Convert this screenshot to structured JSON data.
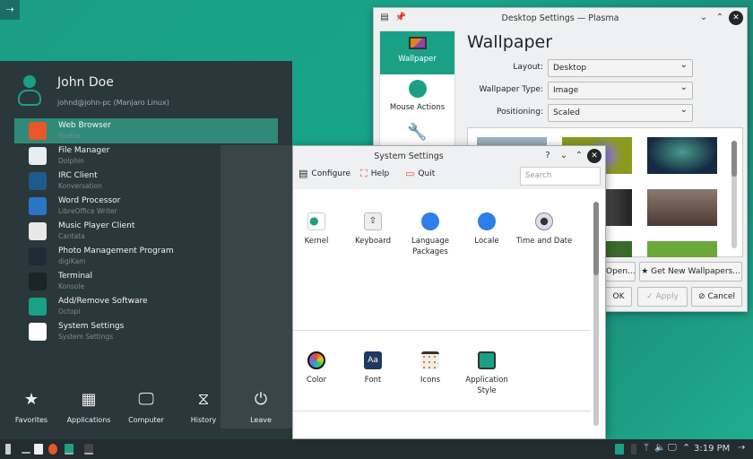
{
  "desktop": {
    "corner_icon": "⇢"
  },
  "desktop_settings": {
    "title": "Desktop Settings — Plasma",
    "sidebar": [
      {
        "label": "Wallpaper",
        "icon": "monitor-icon",
        "selected": true
      },
      {
        "label": "Mouse Actions",
        "icon": "mouse-icon"
      },
      {
        "label": "",
        "icon": "wrench-icon"
      }
    ],
    "heading": "Wallpaper",
    "fields": [
      {
        "label": "Layout:",
        "value": "Desktop"
      },
      {
        "label": "Wallpaper Type:",
        "value": "Image"
      },
      {
        "label": "Positioning:",
        "value": "Scaled"
      }
    ],
    "buttons": {
      "open": "Open...",
      "get_new": "Get New Wallpapers...",
      "ok": "OK",
      "apply": "Apply",
      "cancel": "Cancel"
    }
  },
  "system_settings": {
    "title": "System Settings",
    "toolbar": {
      "configure": "Configure",
      "help": "Help",
      "quit": "Quit"
    },
    "search_placeholder": "Search",
    "row1": [
      {
        "label": "Kernel"
      },
      {
        "label": "Keyboard"
      },
      {
        "label": "Language Packages"
      },
      {
        "label": "Locale"
      },
      {
        "label": "Time and Date"
      }
    ],
    "row2": [
      {
        "label": "Color"
      },
      {
        "label": "Font"
      },
      {
        "label": "Icons"
      },
      {
        "label": "Application Style"
      }
    ]
  },
  "menu": {
    "user_name": "John Doe",
    "user_sub": "johnd@john-pc (Manjaro Linux)",
    "items": [
      {
        "title": "Web Browser",
        "sub": "Firefox",
        "color": "#e8562a"
      },
      {
        "title": "File Manager",
        "sub": "Dolphin",
        "color": "#e6eef0"
      },
      {
        "title": "IRC Client",
        "sub": "Konversation",
        "color": "#1d5a8e"
      },
      {
        "title": "Word Processor",
        "sub": "LibreOffice Writer",
        "color": "#2a76c6"
      },
      {
        "title": "Music Player Client",
        "sub": "Cantata",
        "color": "#e8e8e8"
      },
      {
        "title": "Photo Management Program",
        "sub": "digiKam",
        "color": "#1e2a38"
      },
      {
        "title": "Terminal",
        "sub": "Konsole",
        "color": "#1b2426"
      },
      {
        "title": "Add/Remove Software",
        "sub": "Octopi",
        "color": "#1aa185"
      },
      {
        "title": "System Settings",
        "sub": "System Settings",
        "color": "#ffffff"
      }
    ],
    "tabs": [
      {
        "label": "Favorites",
        "icon": "★"
      },
      {
        "label": "Applications",
        "icon": "▦"
      },
      {
        "label": "Computer",
        "icon": "🖵"
      },
      {
        "label": "History",
        "icon": "⧖"
      },
      {
        "label": "Leave",
        "icon": "⏻"
      }
    ]
  },
  "taskbar": {
    "clock": "3:19 PM"
  }
}
